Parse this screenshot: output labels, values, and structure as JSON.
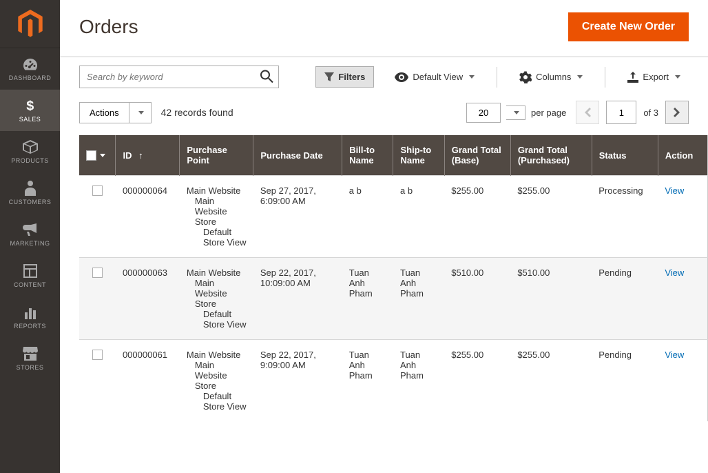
{
  "page_title": "Orders",
  "create_button": "Create New Order",
  "search_placeholder": "Search by keyword",
  "filters_label": "Filters",
  "default_view_label": "Default View",
  "columns_label": "Columns",
  "export_label": "Export",
  "actions_label": "Actions",
  "records_found": "42 records found",
  "per_page_value": "20",
  "per_page_label": "per page",
  "page_current": "1",
  "page_of": "of 3",
  "sidebar": {
    "items": [
      {
        "label": "DASHBOARD"
      },
      {
        "label": "SALES"
      },
      {
        "label": "PRODUCTS"
      },
      {
        "label": "CUSTOMERS"
      },
      {
        "label": "MARKETING"
      },
      {
        "label": "CONTENT"
      },
      {
        "label": "REPORTS"
      },
      {
        "label": "STORES"
      }
    ]
  },
  "columns": {
    "id": "ID",
    "purchase_point": "Purchase Point",
    "purchase_date": "Purchase Date",
    "bill_to": "Bill-to Name",
    "ship_to": "Ship-to Name",
    "grand_base": "Grand Total (Base)",
    "grand_purchased": "Grand Total (Purchased)",
    "status": "Status",
    "action": "Action"
  },
  "rows": [
    {
      "id": "000000064",
      "pp1": "Main Website",
      "pp2": "Main Website Store",
      "pp3": "Default Store View",
      "date": "Sep 27, 2017, 6:09:00 AM",
      "bill": "a b",
      "ship": "a b",
      "base": "$255.00",
      "purchased": "$255.00",
      "status": "Processing",
      "action": "View"
    },
    {
      "id": "000000063",
      "pp1": "Main Website",
      "pp2": "Main Website Store",
      "pp3": "Default Store View",
      "date": "Sep 22, 2017, 10:09:00 AM",
      "bill": "Tuan Anh Pham",
      "ship": "Tuan Anh Pham",
      "base": "$510.00",
      "purchased": "$510.00",
      "status": "Pending",
      "action": "View"
    },
    {
      "id": "000000061",
      "pp1": "Main Website",
      "pp2": "Main Website Store",
      "pp3": "Default Store View",
      "date": "Sep 22, 2017, 9:09:00 AM",
      "bill": "Tuan Anh Pham",
      "ship": "Tuan Anh Pham",
      "base": "$255.00",
      "purchased": "$255.00",
      "status": "Pending",
      "action": "View"
    }
  ]
}
